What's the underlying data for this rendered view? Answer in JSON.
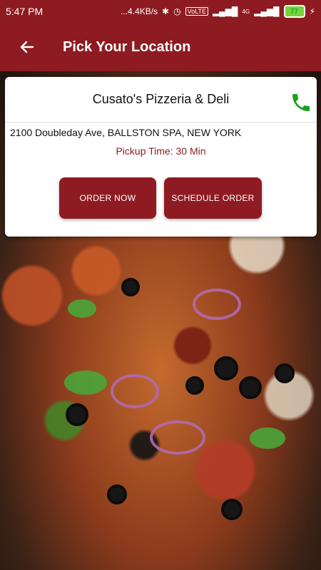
{
  "status_bar": {
    "time": "5:47 PM",
    "network_speed": "...4.4KB/s",
    "network_type": "4G",
    "battery": "77",
    "icons": [
      "bluetooth-icon",
      "alarm-icon",
      "volte-icon",
      "signal-icon",
      "signal-icon",
      "battery-icon",
      "charging-icon"
    ]
  },
  "header": {
    "title": "Pick Your Location",
    "back_icon": "back-arrow-icon"
  },
  "location_card": {
    "name": "Cusato's Pizzeria & Deli",
    "address": "2100 Doubleday Ave, BALLSTON SPA, NEW YORK",
    "pickup_time": "Pickup Time: 30 Min",
    "phone_icon": "phone-icon",
    "order_now_label": "ORDER NOW",
    "schedule_order_label": "SCHEDULE ORDER"
  },
  "colors": {
    "primary": "#8e1b22",
    "phone_green": "#1aa21a",
    "card_bg": "#ffffff"
  }
}
